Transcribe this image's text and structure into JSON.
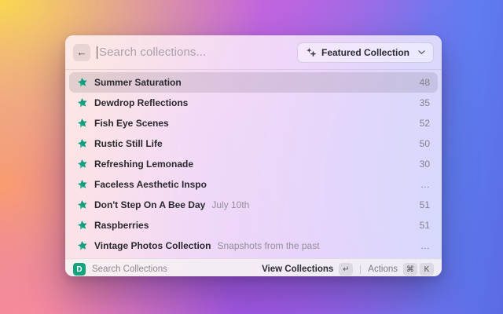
{
  "header": {
    "back_icon": "←",
    "search": {
      "placeholder": "Search collections...",
      "value": ""
    },
    "filter": {
      "label": "Featured Collection"
    }
  },
  "rows": [
    {
      "title": "Summer Saturation",
      "subtitle": "",
      "count": "48",
      "selected": true
    },
    {
      "title": "Dewdrop Reflections",
      "subtitle": "",
      "count": "35"
    },
    {
      "title": "Fish Eye Scenes",
      "subtitle": "",
      "count": "52"
    },
    {
      "title": "Rustic Still Life",
      "subtitle": "",
      "count": "50"
    },
    {
      "title": "Refreshing Lemonade",
      "subtitle": "",
      "count": "30"
    },
    {
      "title": "Faceless Aesthetic Inspo",
      "subtitle": "",
      "count": "…"
    },
    {
      "title": "Don't Step On A Bee Day",
      "subtitle": "July 10th",
      "count": "51"
    },
    {
      "title": "Raspberries",
      "subtitle": "",
      "count": "51"
    },
    {
      "title": "Vintage Photos Collection",
      "subtitle": "Snapshots from the past",
      "count": "…"
    }
  ],
  "footer": {
    "app_icon_letter": "D",
    "left_label": "Search Collections",
    "primary_action": "View Collections",
    "primary_key": "↵",
    "secondary_action": "Actions",
    "secondary_keys": [
      "⌘",
      "K"
    ]
  },
  "colors": {
    "star_green": "#12a381",
    "app_icon_green": "#14a57e"
  }
}
